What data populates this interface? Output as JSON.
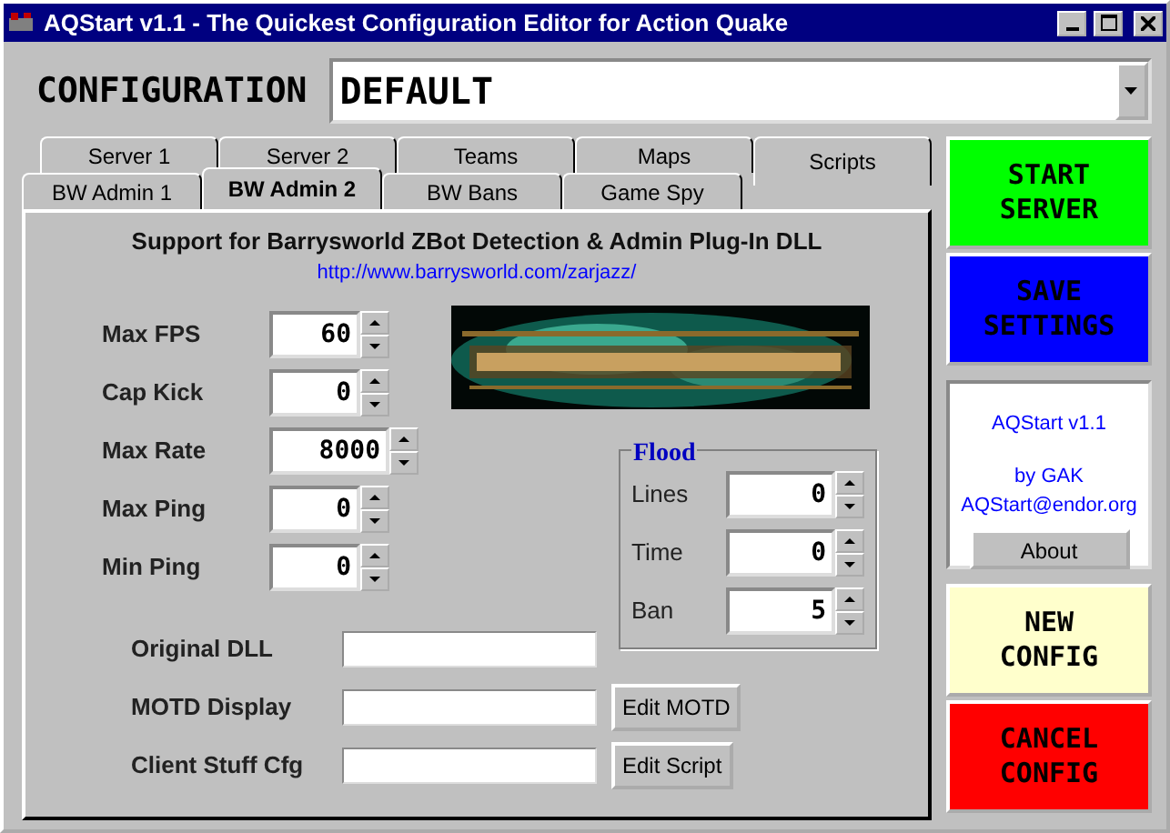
{
  "window": {
    "title": "AQStart v1.1 - The Quickest Configuration Editor for Action Quake"
  },
  "configuration": {
    "label": "CONFIGURATION",
    "value": "DEFAULT"
  },
  "tab_rows": [
    [
      {
        "label": "Server 1",
        "selected": false
      },
      {
        "label": "Server 2",
        "selected": false
      },
      {
        "label": "Teams",
        "selected": false
      },
      {
        "label": "Maps",
        "selected": false
      },
      {
        "label": "Scripts",
        "selected": false
      }
    ],
    [
      {
        "label": "BW Admin 1",
        "selected": false
      },
      {
        "label": "BW Admin 2",
        "selected": true
      },
      {
        "label": "BW Bans",
        "selected": false
      },
      {
        "label": "Game Spy",
        "selected": false
      }
    ]
  ],
  "panel": {
    "heading": "Support for Barrysworld ZBot Detection & Admin Plug-In DLL",
    "link": "http://www.barrysworld.com/zarjazz/",
    "spinners": [
      {
        "label": "Max FPS",
        "value": "60"
      },
      {
        "label": "Cap Kick",
        "value": "0"
      },
      {
        "label": "Max Rate",
        "value": "8000"
      },
      {
        "label": "Max Ping",
        "value": "0"
      },
      {
        "label": "Min Ping",
        "value": "0"
      }
    ],
    "flood": {
      "title": "Flood",
      "spinners": [
        {
          "label": "Lines",
          "value": "0"
        },
        {
          "label": "Time",
          "value": "0"
        },
        {
          "label": "Ban",
          "value": "5"
        }
      ]
    },
    "fields": [
      {
        "label": "Original DLL"
      },
      {
        "label": "MOTD Display",
        "button": "Edit MOTD"
      },
      {
        "label": "Client Stuff Cfg",
        "button": "Edit Script"
      }
    ]
  },
  "side_buttons": [
    {
      "label": "START SERVER",
      "color": "#00ff00"
    },
    {
      "label": "SAVE SETTINGS",
      "color": "#0000ff"
    }
  ],
  "about": {
    "version": "AQStart v1.1",
    "author": "by GAK",
    "email": "AQStart@endor.org",
    "button": "About"
  },
  "side_buttons_lower": [
    {
      "label": "NEW CONFIG",
      "color": "#ffffcc"
    },
    {
      "label": "CANCEL CONFIG",
      "color": "#ff0000"
    }
  ]
}
